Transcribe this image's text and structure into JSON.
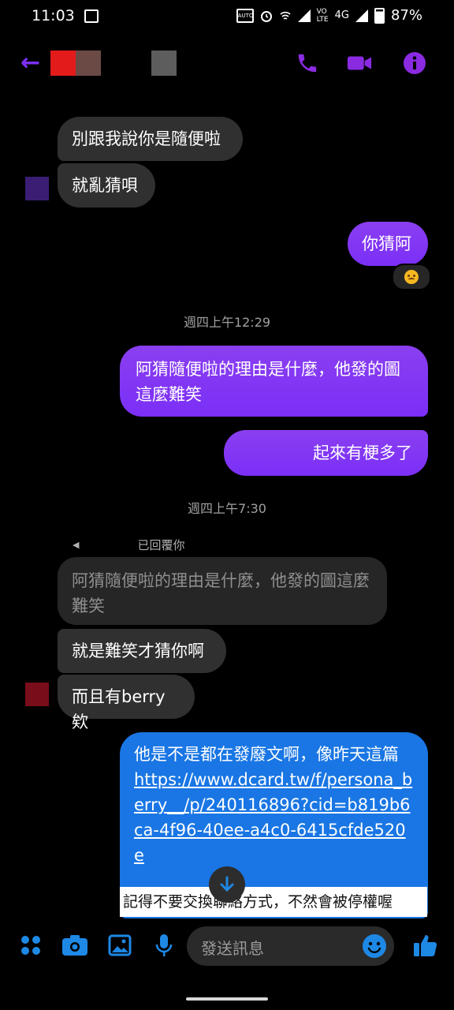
{
  "status": {
    "time": "11:03",
    "battery": "87%",
    "network": "4G"
  },
  "header": {
    "accent": "#7b2ff7"
  },
  "messages": {
    "m1": "別跟我說你是隨便啦",
    "m2": "就亂猜唄",
    "m3": "你猜阿",
    "ts1": "週四上午12:29",
    "m4": "阿猜隨便啦的理由是什麼，他發的圖這麼難笑",
    "m5": "起來有梗多了",
    "ts2": "週四上午7:30",
    "reply_label": "已回覆你",
    "quoted": "阿猜隨便啦的理由是什麼，他發的圖這麼難笑",
    "m6": "就是難笑才猜你啊",
    "m7": "而且有berry欸",
    "m8_text": "他是不是都在發廢文啊，像昨天這篇",
    "m8_link": "https://www.dcard.tw/f/persona_berry__/p/240116896?cid=b819b6ca-4f96-40ee-a4c0-6415cfde520e"
  },
  "notice": "記得不要交換聯絡方式，不然會被停權喔",
  "composer": {
    "placeholder": "發送訊息"
  },
  "colors": {
    "outgoing": "#7b2ff7",
    "incoming": "#303030",
    "link_bubble": "#1976e4",
    "toolbar_icon": "#1e88e5"
  }
}
